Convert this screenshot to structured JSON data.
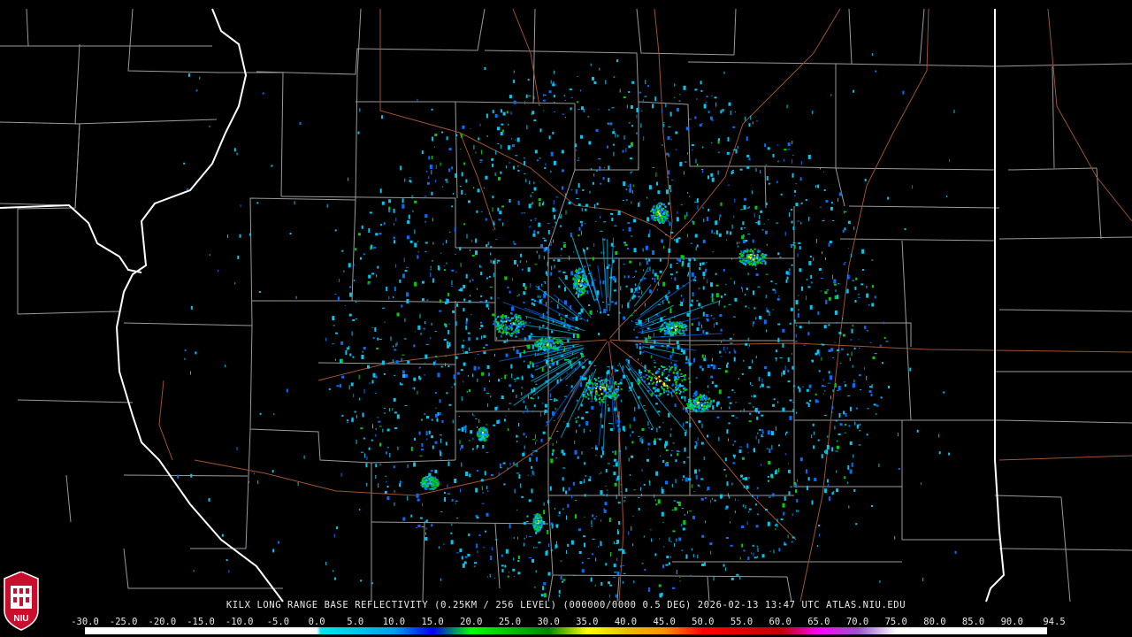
{
  "product_title": "KILX LONG RANGE BASE REFLECTIVITY (0.25KM / 256 LEVEL) (000000/0000 0.5 DEG) 2026-02-13 13:47 UTC  ATLAS.NIU.EDU",
  "logo_text": "NIU",
  "colorbar": {
    "ticks": [
      "-30.0",
      "-25.0",
      "-20.0",
      "-15.0",
      "-10.0",
      "-5.0",
      "0.0",
      "5.0",
      "10.0",
      "15.0",
      "20.0",
      "25.0",
      "30.0",
      "35.0",
      "40.0",
      "45.0",
      "50.0",
      "55.0",
      "60.0",
      "65.0",
      "70.0",
      "75.0",
      "80.0",
      "85.0",
      "90.0",
      "94.5"
    ],
    "stops": [
      {
        "dbz": -30,
        "color": "#ffffff"
      },
      {
        "dbz": 0,
        "color": "#ffffff"
      },
      {
        "dbz": 0.5,
        "color": "#00e8e8"
      },
      {
        "dbz": 10,
        "color": "#00a0f0"
      },
      {
        "dbz": 15,
        "color": "#0000f0"
      },
      {
        "dbz": 20,
        "color": "#00ff00"
      },
      {
        "dbz": 30,
        "color": "#008800"
      },
      {
        "dbz": 35,
        "color": "#ffff00"
      },
      {
        "dbz": 40,
        "color": "#e8c000"
      },
      {
        "dbz": 45,
        "color": "#ff9000"
      },
      {
        "dbz": 50,
        "color": "#ff0000"
      },
      {
        "dbz": 60,
        "color": "#c00000"
      },
      {
        "dbz": 65,
        "color": "#ff00ff"
      },
      {
        "dbz": 70,
        "color": "#9955c9"
      },
      {
        "dbz": 75,
        "color": "#ffffff"
      },
      {
        "dbz": 94.5,
        "color": "#ffffff"
      }
    ]
  },
  "colors": {
    "background": "#000000",
    "county_lines": "#9a9a9a",
    "state_lines": "#ffffff",
    "highways": "#a0522d",
    "echo_light": "#00c8f0",
    "echo_mid": "#0070ff",
    "echo_strong": "#00d000",
    "echo_peak": "#ffff00"
  }
}
